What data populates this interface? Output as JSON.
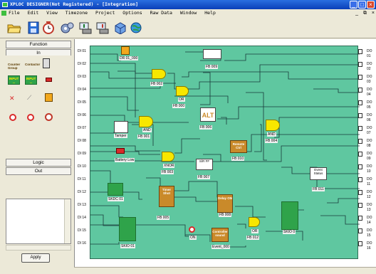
{
  "window": {
    "title": "XPLOC DESIGNER(Not Registered) - [Integration]",
    "min": "_",
    "max": "□",
    "close": "×"
  },
  "menu": [
    "File",
    "Edit",
    "View",
    "Timezone",
    "Project",
    "Options",
    "Raw Data",
    "Window",
    "Help"
  ],
  "mdi": {
    "min": "_",
    "restore": "⧉",
    "close": "×"
  },
  "toolbar_icons": [
    "open-folder-icon",
    "save-icon",
    "clock-icon",
    "settings-icon",
    "upload-icon",
    "download-icon",
    "cube-icon",
    "globe-icon"
  ],
  "left_panel": {
    "function_tab": "Function",
    "in_tab": "In",
    "palette": {
      "counter": "Counter Group",
      "contactor": "Contactor",
      "status": "status",
      "input1": "INPUT ...",
      "input2": "INPUT ..."
    },
    "logic_tab": "Logic",
    "out_tab": "Out",
    "apply": "Apply"
  },
  "canvas": {
    "inputs": [
      "DI 01",
      "DI 02",
      "DI 03",
      "DI 04",
      "DI 05",
      "DI 06",
      "DI 07",
      "DI 08",
      "DI 09",
      "DI 10",
      "DI 11",
      "DI 12",
      "DI 13",
      "DI 14",
      "DI 15",
      "DI 16"
    ],
    "outputs": [
      "DO 01",
      "DO 02",
      "DO 03",
      "DO 04",
      "DO 05",
      "DO 06",
      "DO 07",
      "DO 08",
      "DO 09",
      "DO 10",
      "DO 11",
      "DO 12",
      "DO 13",
      "DO 14",
      "DO 15",
      "DO 16"
    ],
    "blocks": {
      "dr": "DR 01_000",
      "fb002": "FB 002",
      "fb009": "FB 009",
      "fb000": "FB 000",
      "or_tag": "OR",
      "fb006": "FB 006",
      "alt": "ALT",
      "fb001": "FB 001",
      "tamper": "Tamper",
      "and_tag": "AND",
      "fb004": "FB 004",
      "xor_tag": "XOR",
      "fb010": "FB 010",
      "remote": "Remote Ctrl",
      "battery": "Battery Low",
      "fb003": "FB 003",
      "xnor": "XNOR",
      "fb007": "FB 007",
      "srff": "S/R FF",
      "fb011": "FB 011",
      "event": "Event Status",
      "skdc": "SKDC 01",
      "timer": "Timer Shot",
      "fb005": "FB 005",
      "fb008": "FB 008",
      "delay": "Delay ON",
      "nor_tag": "OR",
      "fb012": "FB 012",
      "event_block": "Event_000",
      "on": "ON",
      "skio0": "SKIO 0",
      "skio01": "SKIO 01",
      "ctl": "Controller sound"
    }
  },
  "colors": {
    "board": "#5fc7a0",
    "title": "#0a3fb8",
    "gate": "#f7e700",
    "wire": "#1a3a3a"
  }
}
